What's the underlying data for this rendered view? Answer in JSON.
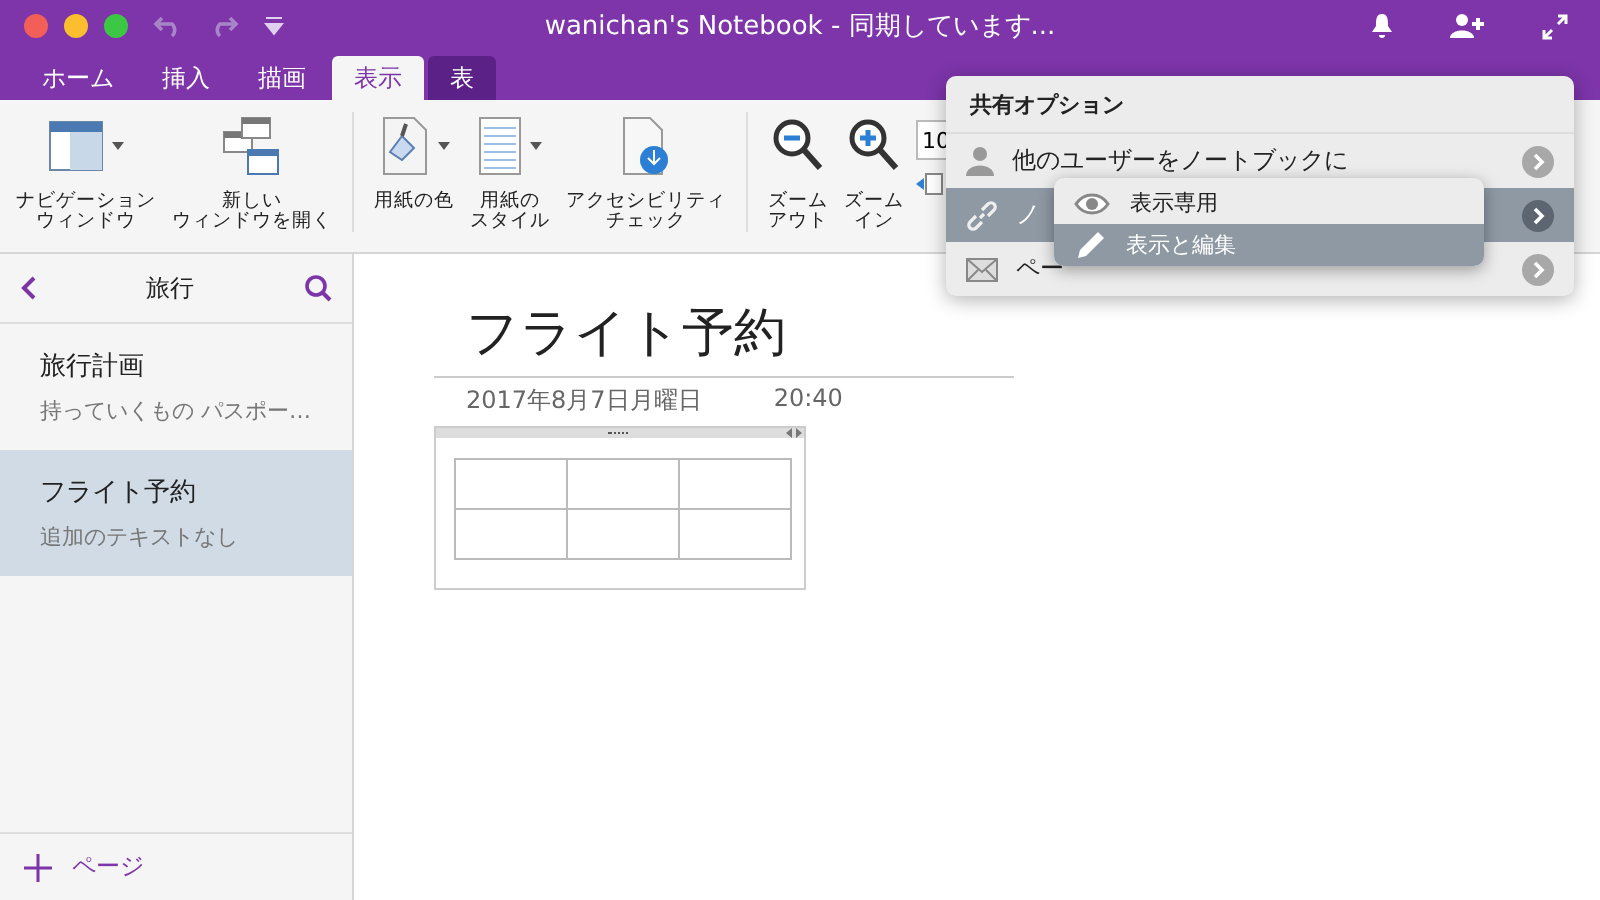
{
  "window": {
    "title": "wanichan's Notebook - 同期しています..."
  },
  "tabs": [
    {
      "label": "ホーム",
      "selected": false
    },
    {
      "label": "挿入",
      "selected": false
    },
    {
      "label": "描画",
      "selected": false
    },
    {
      "label": "表示",
      "selected": true
    },
    {
      "label": "表",
      "selected": false,
      "kind": "context"
    }
  ],
  "ribbon": [
    {
      "lines": [
        "ナビゲーション",
        "ウィンドウ"
      ],
      "kind": "nav",
      "dropdown": true
    },
    {
      "lines": [
        "新しい",
        "ウィンドウを開く"
      ],
      "kind": "windows",
      "dropdown": false
    },
    {
      "lines": [
        "用紙の色"
      ],
      "kind": "paint",
      "dropdown": true
    },
    {
      "lines": [
        "用紙の",
        "スタイル"
      ],
      "kind": "paper",
      "dropdown": true
    },
    {
      "lines": [
        "アクセシビリティ",
        "チェック"
      ],
      "kind": "access",
      "dropdown": false
    },
    {
      "lines": [
        "ズーム",
        "アウト"
      ],
      "kind": "zoomout",
      "dropdown": false
    },
    {
      "lines": [
        "ズーム",
        "イン"
      ],
      "kind": "zoomin",
      "dropdown": false
    }
  ],
  "zoom_field": {
    "value": "10"
  },
  "sidebar": {
    "title": "旅行",
    "pages": [
      {
        "title": "旅行計画",
        "preview": "持っていくもの  パスポー…",
        "selected": false
      },
      {
        "title": "フライト予約",
        "preview": "追加のテキストなし",
        "selected": true
      }
    ],
    "add_label": "ページ"
  },
  "page": {
    "title": "フライト予約",
    "date": "2017年8月7日月曜日",
    "time": "20:40"
  },
  "share_menu": {
    "title": "共有オプション",
    "items": [
      {
        "label": "他のユーザーをノートブックに",
        "kind": "person",
        "selected": false
      },
      {
        "label": "ノ",
        "kind": "link",
        "selected": true
      },
      {
        "label": "ペー",
        "kind": "mail",
        "selected": false
      }
    ]
  },
  "submenu": {
    "items": [
      {
        "label": "表示専用",
        "kind": "eye",
        "selected": false
      },
      {
        "label": "表示と編集",
        "kind": "pencil",
        "selected": true
      }
    ]
  }
}
